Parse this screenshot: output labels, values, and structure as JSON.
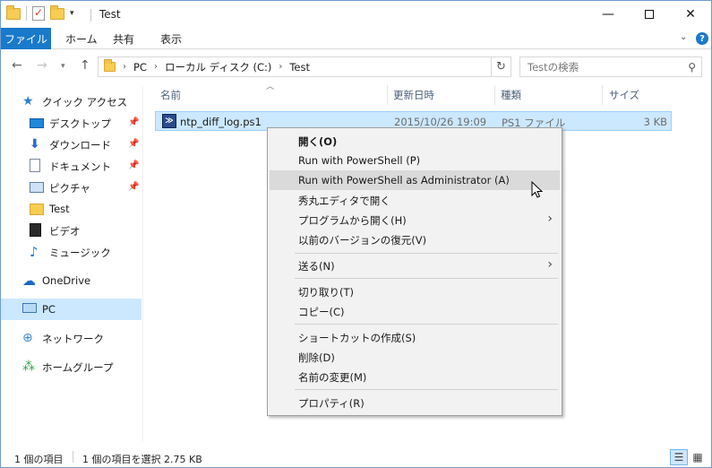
{
  "window": {
    "title": "Test",
    "controls": {
      "minimize": "—",
      "maximize": "",
      "close": "✕"
    }
  },
  "ribbon": {
    "file_tab": "ファイル",
    "tabs": [
      "ホーム",
      "共有",
      "表示"
    ]
  },
  "address": {
    "crumbs": [
      "PC",
      "ローカル ディスク (C:)",
      "Test"
    ],
    "search_placeholder": "Testの検索"
  },
  "navpane": {
    "quick_access": "クイック アクセス",
    "items": [
      {
        "label": "デスクトップ",
        "icon": "desktop-icon",
        "pinned": true
      },
      {
        "label": "ダウンロード",
        "icon": "download-icon",
        "pinned": true
      },
      {
        "label": "ドキュメント",
        "icon": "documents-icon",
        "pinned": true
      },
      {
        "label": "ピクチャ",
        "icon": "pictures-icon",
        "pinned": true
      },
      {
        "label": "Test",
        "icon": "folder-icon",
        "pinned": false
      },
      {
        "label": "ビデオ",
        "icon": "videos-icon",
        "pinned": false
      },
      {
        "label": "ミュージック",
        "icon": "music-icon",
        "pinned": false
      }
    ],
    "onedrive": "OneDrive",
    "pc": "PC",
    "network": "ネットワーク",
    "homegroup": "ホームグループ"
  },
  "filelist": {
    "columns": [
      "名前",
      "更新日時",
      "種類",
      "サイズ"
    ],
    "rows": [
      {
        "name": "ntp_diff_log.ps1",
        "date": "2015/10/26 19:09",
        "type": "PS1 ファイル",
        "size": "3 KB"
      }
    ]
  },
  "context_menu": {
    "items": [
      {
        "label": "開く(O)",
        "bold": true
      },
      {
        "label": "Run with PowerShell (P)"
      },
      {
        "label": "Run with PowerShell as Administrator (A)",
        "highlighted": true
      },
      {
        "label": "秀丸エディタで開く"
      },
      {
        "label": "プログラムから開く(H)",
        "submenu": true
      },
      {
        "label": "以前のバージョンの復元(V)"
      },
      {
        "label": "送る(N)",
        "submenu": true
      },
      {
        "label": "切り取り(T)"
      },
      {
        "label": "コピー(C)"
      },
      {
        "label": "ショートカットの作成(S)"
      },
      {
        "label": "削除(D)"
      },
      {
        "label": "名前の変更(M)"
      },
      {
        "label": "プロパティ(R)"
      }
    ]
  },
  "statusbar": {
    "item_count": "1 個の項目",
    "selection": "1 個の項目を選択  2.75 KB"
  },
  "colors": {
    "accent": "#1979ca",
    "selection_bg": "#cce8ff",
    "menu_bg": "#f2f2f2",
    "menu_highlight": "#dadada"
  }
}
